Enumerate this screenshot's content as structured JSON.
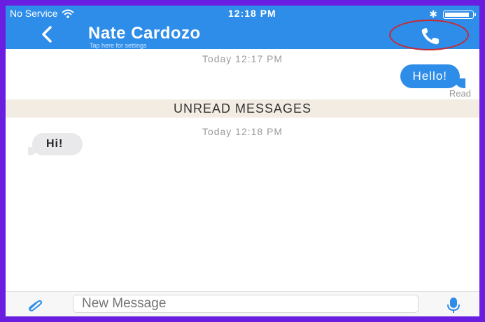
{
  "status_bar": {
    "carrier": "No Service",
    "time": "12:18 PM",
    "bluetooth": "✱"
  },
  "header": {
    "contact_name": "Nate Cardozo",
    "subtitle": "Tap here for settings"
  },
  "messages": {
    "timestamp_1": "Today 12:17 PM",
    "outgoing_text": "Hello!",
    "outgoing_status": "Read",
    "unread_banner": "UNREAD MESSAGES",
    "timestamp_2": "Today 12:18 PM",
    "incoming_text": "Hi!"
  },
  "composer": {
    "placeholder": "New Message"
  },
  "colors": {
    "accent": "#2e8de8",
    "frame": "#6a1fe0",
    "highlight": "#c72a33"
  }
}
